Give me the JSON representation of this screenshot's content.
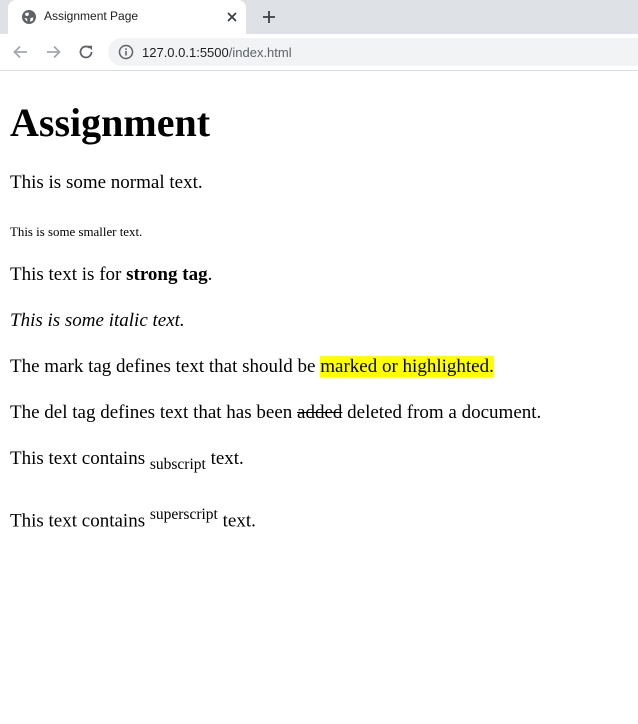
{
  "browser": {
    "tab": {
      "title": "Assignment Page",
      "favicon_icon": "globe-icon",
      "close_icon": "close-icon"
    },
    "new_tab_icon": "plus-icon",
    "toolbar": {
      "back_icon": "arrow-left-icon",
      "forward_icon": "arrow-right-icon",
      "reload_icon": "reload-icon",
      "site_info_icon": "info-icon",
      "url_host": "127.0.0.1:5500",
      "url_path": "/index.html"
    },
    "colors": {
      "tabstrip": "#dee1e6",
      "omnibox": "#f1f3f4",
      "mark_highlight": "#ffff00"
    }
  },
  "page": {
    "heading": "Assignment",
    "normal_text": "This is some normal text.",
    "small_text": "This is some smaller text.",
    "strong": {
      "before": "This text is for ",
      "bold": "strong tag",
      "after": "."
    },
    "italic_text": "This is some italic text.",
    "mark": {
      "before": "The mark tag defines text that should be ",
      "highlighted": "marked or highlighted."
    },
    "del": {
      "before": "The del tag defines text that has been ",
      "deleted": "added",
      "after": " deleted from a document."
    },
    "sub": {
      "before": "This text contains ",
      "subscript": "subscript",
      "after": " text."
    },
    "sup": {
      "before": "This text contains ",
      "superscript": "superscript",
      "after": " text."
    }
  }
}
